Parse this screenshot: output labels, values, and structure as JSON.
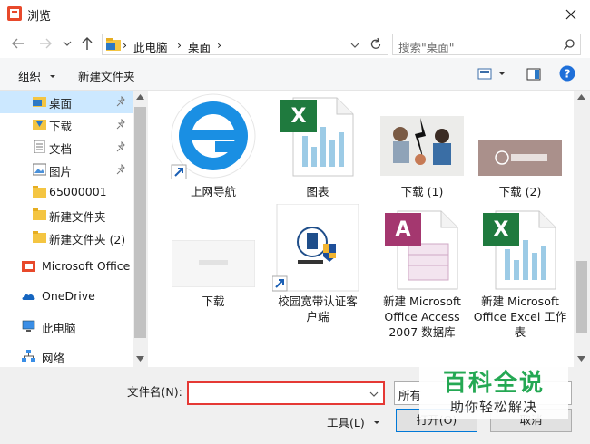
{
  "window": {
    "title": "浏览"
  },
  "address": {
    "crumbs": [
      "此电脑",
      "桌面"
    ],
    "separator": "›"
  },
  "search": {
    "placeholder": "搜索\"桌面\""
  },
  "toolbar": {
    "organize_label": "组织",
    "new_folder_label": "新建文件夹"
  },
  "sidebar": {
    "items": [
      {
        "label": "桌面",
        "icon": "desktop-folder-icon",
        "pinned": true,
        "selected": true
      },
      {
        "label": "下载",
        "icon": "download-folder-icon",
        "pinned": true
      },
      {
        "label": "文档",
        "icon": "documents-folder-icon",
        "pinned": true
      },
      {
        "label": "图片",
        "icon": "pictures-folder-icon",
        "pinned": true
      },
      {
        "label": "65000001",
        "icon": "folder-icon"
      },
      {
        "label": "新建文件夹",
        "icon": "folder-icon"
      },
      {
        "label": "新建文件夹 (2)",
        "icon": "folder-icon"
      },
      {
        "label": "Microsoft Office",
        "icon": "office-icon"
      },
      {
        "label": "OneDrive",
        "icon": "onedrive-icon"
      },
      {
        "label": "此电脑",
        "icon": "computer-icon"
      },
      {
        "label": "网络",
        "icon": "network-icon"
      }
    ]
  },
  "files": [
    {
      "label": "上网导航",
      "icon": "ie-shortcut-icon"
    },
    {
      "label": "图表",
      "icon": "excel-file-icon"
    },
    {
      "label": "下载 (1)",
      "icon": "image-thumbnail-icon"
    },
    {
      "label": "下载 (2)",
      "icon": "image-thumbnail-icon"
    },
    {
      "label": "下载",
      "icon": "image-thumbnail-icon"
    },
    {
      "label_line1": "校园宽带认证客",
      "label_line2": "户端",
      "icon": "app-shortcut-icon"
    },
    {
      "label_line1": "新建 Microsoft",
      "label_line2": "Office Access",
      "label_line3": "2007 数据库",
      "icon": "access-file-icon"
    },
    {
      "label_line1": "新建 Microsoft",
      "label_line2": "Office Excel 工作",
      "label_line3": "表",
      "icon": "excel-file-icon"
    }
  ],
  "footer": {
    "filename_label": "文件名(N):",
    "filename_value": "",
    "filter_text": "所有",
    "tools_label": "工具(L)",
    "open_label": "打开(O)",
    "cancel_label": "取消"
  },
  "watermark": {
    "title": "百科全说",
    "subtitle": "助你轻松解决"
  },
  "colors": {
    "accent": "#0078d7",
    "selection": "#cce8ff",
    "highlight_border": "#e53935",
    "watermark_green": "#24a853"
  }
}
